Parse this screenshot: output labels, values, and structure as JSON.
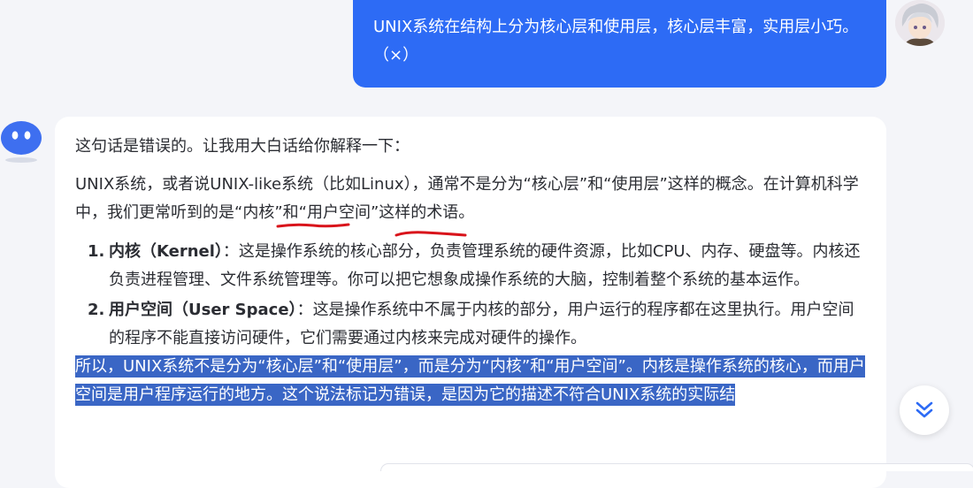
{
  "user_message": {
    "text": "UNIX系统在结构上分为核心层和使用层，核心层丰富，实用层小巧。（×）"
  },
  "assistant_message": {
    "intro": "这句话是错误的。让我用大白话给你解释一下：",
    "para1": "UNIX系统，或者说UNIX-like系统（比如Linux），通常不是分为“核心层”和“使用层”这样的概念。在计算机科学中，我们更常听到的是“内核”和“用户空间”这样的术语。",
    "list": [
      {
        "num": "1.",
        "term": "内核（Kernel）",
        "sep": "：",
        "desc": "这是操作系统的核心部分，负责管理系统的硬件资源，比如CPU、内存、硬盘等。内核还负责进程管理、文件系统管理等。你可以把它想象成操作系统的大脑，控制着整个系统的基本运作。"
      },
      {
        "num": "2.",
        "term": "用户空间（User Space）",
        "sep": "：",
        "desc": "这是操作系统中不属于内核的部分，用户运行的程序都在这里执行。用户空间的程序不能直接访问硬件，它们需要通过内核来完成对硬件的操作。"
      }
    ],
    "highlighted": "所以，UNIX系统不是分为“核心层”和“使用层”，而是分为“内核”和“用户空间”。内核是操作系统的核心，而用户空间是用户程序运行的地方。这个说法标记为错误，是因为它的描述不符合UNIX系统的实际结"
  },
  "icons": {
    "bot_avatar": "bot-face-icon",
    "user_avatar": "user-avatar",
    "scroll_down": "double-chevron-down-icon"
  },
  "colors": {
    "user_bubble": "#2d6bf5",
    "selection_highlight": "#3a66c5",
    "annotation_underline": "#d9141b",
    "page_background": "#f4f5f9"
  }
}
